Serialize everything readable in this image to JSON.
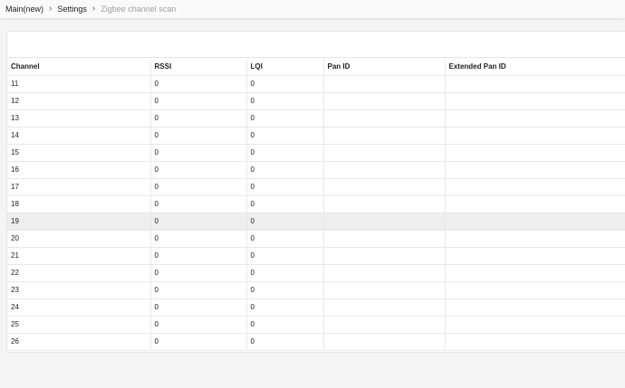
{
  "breadcrumb": {
    "items": [
      {
        "label": "Main(new)"
      },
      {
        "label": "Settings"
      },
      {
        "label": "Zigbee channel scan"
      }
    ]
  },
  "table": {
    "headers": [
      "Channel",
      "RSSI",
      "LQI",
      "Pan ID",
      "Extended Pan ID"
    ],
    "rows": [
      [
        "11",
        "0",
        "0",
        "",
        ""
      ],
      [
        "12",
        "0",
        "0",
        "",
        ""
      ],
      [
        "13",
        "0",
        "0",
        "",
        ""
      ],
      [
        "14",
        "0",
        "0",
        "",
        ""
      ],
      [
        "15",
        "0",
        "0",
        "",
        ""
      ],
      [
        "16",
        "0",
        "0",
        "",
        ""
      ],
      [
        "17",
        "0",
        "0",
        "",
        ""
      ],
      [
        "18",
        "0",
        "0",
        "",
        ""
      ],
      [
        "19",
        "0",
        "0",
        "",
        ""
      ],
      [
        "20",
        "0",
        "0",
        "",
        ""
      ],
      [
        "21",
        "0",
        "0",
        "",
        ""
      ],
      [
        "22",
        "0",
        "0",
        "",
        ""
      ],
      [
        "23",
        "0",
        "0",
        "",
        ""
      ],
      [
        "24",
        "0",
        "0",
        "",
        ""
      ],
      [
        "25",
        "0",
        "0",
        "",
        ""
      ],
      [
        "26",
        "0",
        "0",
        "",
        ""
      ]
    ],
    "highlighted_row": 8
  },
  "icons": {
    "breadcrumb_separator": "chevron-right-icon"
  }
}
